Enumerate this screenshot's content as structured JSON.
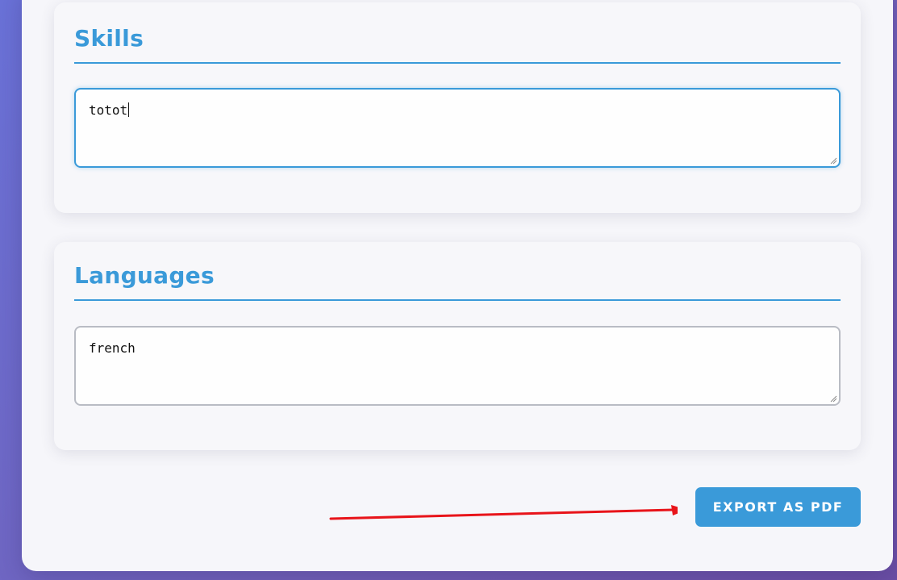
{
  "skills": {
    "title": "Skills",
    "value": "totot"
  },
  "languages": {
    "title": "Languages",
    "value": "french"
  },
  "actions": {
    "export_label": "EXPORT AS PDF"
  },
  "colors": {
    "accent": "#3a9ad9",
    "annotation_arrow": "#e8141a",
    "background_gradient_start": "#6a72d8",
    "background_gradient_end": "#6c4fa6"
  },
  "icons": {
    "resize": "resize-grip-icon",
    "arrow": "annotation-arrow-icon"
  }
}
